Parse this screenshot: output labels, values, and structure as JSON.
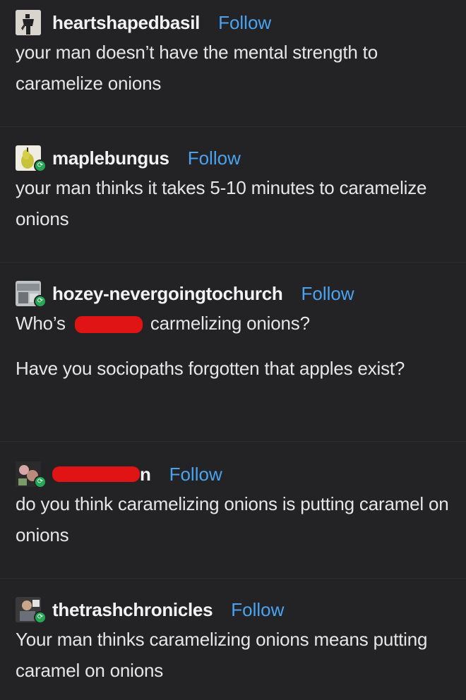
{
  "posts": [
    {
      "username": "heartshapedbasil",
      "follow_label": "Follow",
      "avatar_icon": "person-silhouette-icon",
      "text": [
        "your man doesn’t have the mental strength to caramelize onions"
      ]
    },
    {
      "username": "maplebungus",
      "follow_label": "Follow",
      "avatar_icon": "pear-avatar-icon",
      "reblog": true,
      "text": [
        "your man thinks it takes 5-10 minutes to caramelize onions"
      ]
    },
    {
      "username": "hozey-nevergoingtochurch",
      "follow_label": "Follow",
      "avatar_icon": "photo-avatar-icon",
      "reblog": true,
      "text_before_redaction": "Who’s",
      "text_after_redaction": "carmelizing onions?",
      "text": [
        "Have you sociopaths forgotten that apples exist?"
      ]
    },
    {
      "username_visible_suffix": "n",
      "follow_label": "Follow",
      "avatar_icon": "photo-avatar-icon",
      "reblog": true,
      "text": [
        "do you think caramelizing onions is putting caramel on onions"
      ]
    },
    {
      "username": "thetrashchronicles",
      "follow_label": "Follow",
      "avatar_icon": "photo-avatar-icon",
      "reblog": true,
      "text": [
        "Your man thinks caramelizing onions means putting caramel on onions"
      ]
    }
  ],
  "colors": {
    "background": "#232325",
    "text": "#e6e6e7",
    "follow": "#4aa3f0",
    "reblog_badge": "#25a853",
    "redaction": "#e01414"
  }
}
